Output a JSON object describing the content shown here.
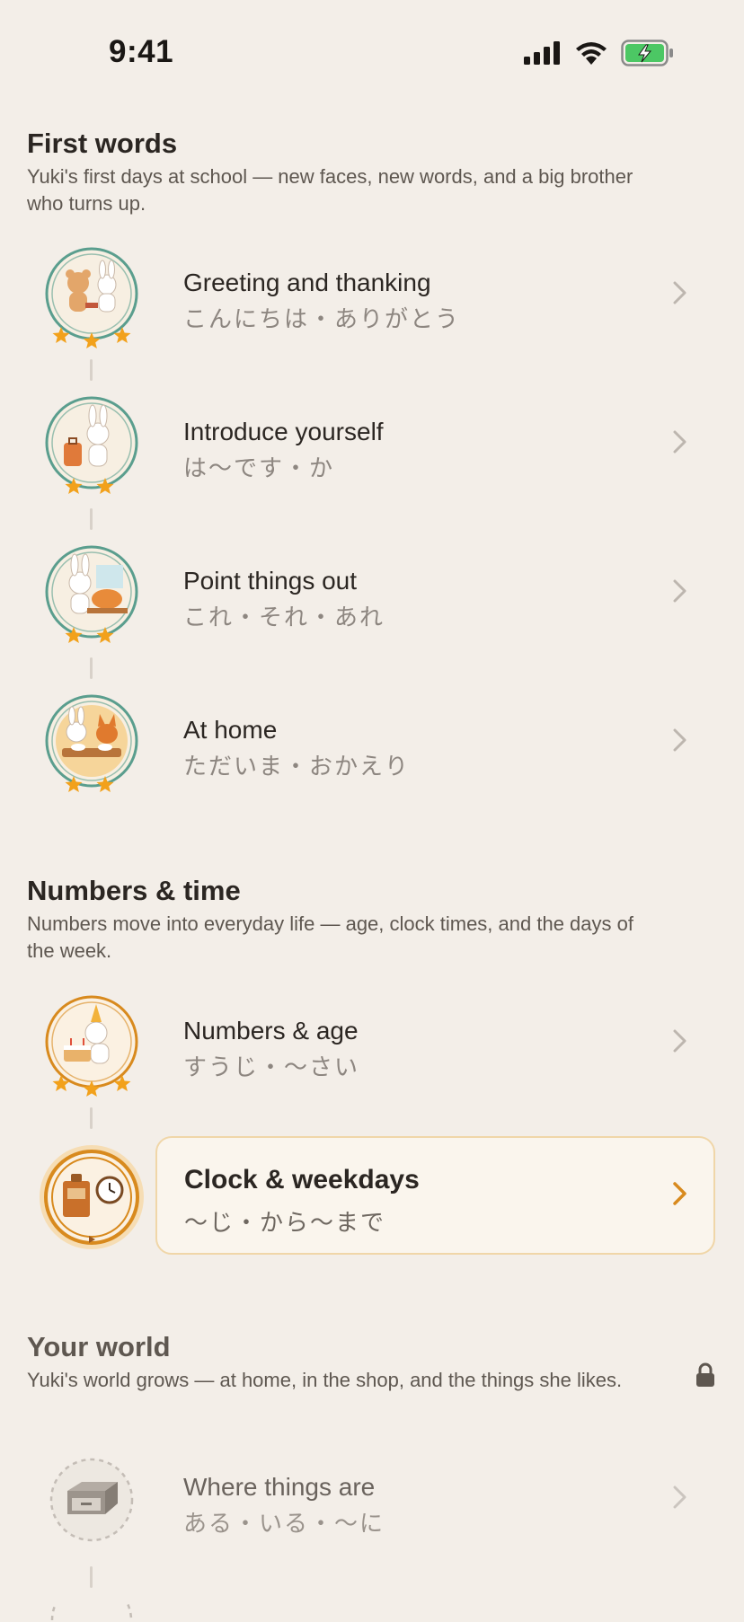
{
  "status_bar": {
    "time": "9:41"
  },
  "sections": [
    {
      "title": "First words",
      "description": "Yuki's first days at school — new faces, new words, and a big brother who turns up.",
      "lessons": [
        {
          "title": "Greeting and thanking",
          "subtitle": "こんにちは・ありがとう",
          "stars": 3,
          "icon": "bear-and-rabbit-bowing"
        },
        {
          "title": "Introduce yourself",
          "subtitle": "は〜です・か",
          "stars": 2,
          "icon": "rabbit-with-suitcase"
        },
        {
          "title": "Point things out",
          "subtitle": "これ・それ・あれ",
          "stars": 2,
          "icon": "rabbit-with-cat"
        },
        {
          "title": "At home",
          "subtitle": "ただいま・おかえり",
          "stars": 2,
          "icon": "rabbit-and-fox-eating"
        }
      ]
    },
    {
      "title": "Numbers & time",
      "description": "Numbers move into everyday life — age, clock times, and the days of the week.",
      "lessons": [
        {
          "title": "Numbers & age",
          "subtitle": "すうじ・〜さい",
          "stars": 3,
          "icon": "rabbit-with-birthday-cake"
        },
        {
          "title": "Clock & weekdays",
          "subtitle": "〜じ・から〜まで",
          "stars": 0,
          "icon": "clock-and-door",
          "state": "current"
        }
      ]
    },
    {
      "title": "Your world",
      "description": "Yuki's world grows — at home, in the shop, and the things she likes.",
      "locked": true,
      "lessons": [
        {
          "title": "Where things are",
          "subtitle": "ある・いる・〜に",
          "icon": "drawer",
          "state": "locked"
        }
      ]
    }
  ],
  "colors": {
    "background": "#F3EEE8",
    "completed_ring": "#5A9E8E",
    "numbers_ring": "#D88A1E",
    "star": "#F2A11B",
    "active_card_border": "#F0D6A8"
  }
}
